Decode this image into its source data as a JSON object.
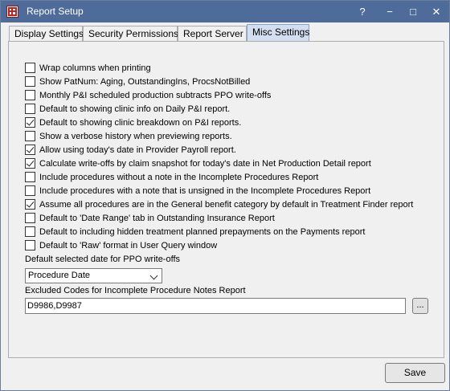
{
  "window": {
    "title": "Report Setup",
    "help_label": "?",
    "minimize_label": "−",
    "maximize_label": "□",
    "close_label": "✕"
  },
  "tabs": [
    {
      "label": "Display Settings",
      "active": false
    },
    {
      "label": "Security Permissions",
      "active": false
    },
    {
      "label": "Report Server",
      "active": false
    },
    {
      "label": "Misc Settings",
      "active": true
    }
  ],
  "checkboxes": [
    {
      "label": "Wrap columns when printing",
      "checked": false
    },
    {
      "label": "Show PatNum: Aging, OutstandingIns, ProcsNotBilled",
      "checked": false
    },
    {
      "label": "Monthly P&I scheduled production subtracts PPO write-offs",
      "checked": false
    },
    {
      "label": "Default to showing clinic info on Daily P&I report.",
      "checked": false
    },
    {
      "label": "Default to showing clinic breakdown on P&I reports.",
      "checked": true
    },
    {
      "label": "Show a verbose history when previewing reports.",
      "checked": false
    },
    {
      "label": "Allow using today's date in Provider Payroll report.",
      "checked": true
    },
    {
      "label": "Calculate write-offs by claim snapshot for today's date in Net Production Detail report",
      "checked": true
    },
    {
      "label": "Include procedures without a note in the Incomplete Procedures Report",
      "checked": false
    },
    {
      "label": "Include procedures with a note that is unsigned in the Incomplete Procedures Report",
      "checked": false
    },
    {
      "label": "Assume all procedures are in the General benefit category by default in Treatment Finder report",
      "checked": true
    },
    {
      "label": "Default to 'Date Range' tab in Outstanding Insurance Report",
      "checked": false
    },
    {
      "label": "Default to including hidden treatment planned prepayments on the Payments report",
      "checked": false
    },
    {
      "label": "Default to 'Raw' format  in User Query window",
      "checked": false
    }
  ],
  "ppo_date": {
    "label": "Default selected date for PPO write-offs",
    "selected": "Procedure Date"
  },
  "excluded_codes": {
    "label": "Excluded Codes for Incomplete Procedure Notes Report",
    "value": "D9986,D9987",
    "browse_label": "..."
  },
  "save_label": "Save"
}
